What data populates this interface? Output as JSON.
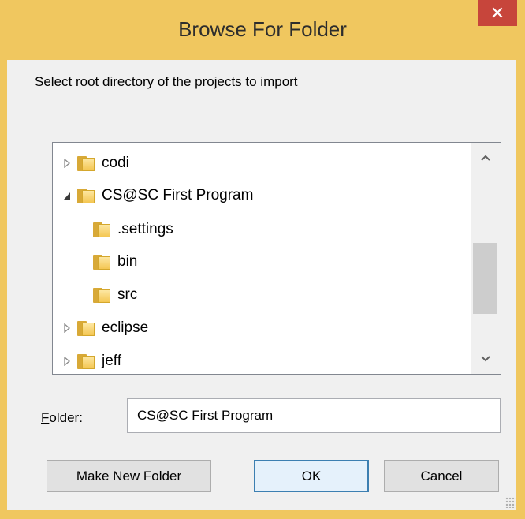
{
  "window": {
    "title": "Browse For Folder",
    "close_symbol": "✕"
  },
  "prompt": "Select root directory of the projects to import",
  "tree": {
    "items": [
      {
        "label": "codi",
        "expander": "collapsed",
        "level": 0
      },
      {
        "label": "CS@SC First Program",
        "expander": "expanded",
        "level": 0,
        "selected": true
      },
      {
        "label": ".settings",
        "expander": "none",
        "level": 1
      },
      {
        "label": "bin",
        "expander": "none",
        "level": 1
      },
      {
        "label": "src",
        "expander": "none",
        "level": 1
      },
      {
        "label": "eclipse",
        "expander": "collapsed",
        "level": 0
      },
      {
        "label": "jeff",
        "expander": "collapsed",
        "level": 0
      }
    ],
    "scroll_up_symbol": "^",
    "scroll_down_symbol": "v"
  },
  "folder_field": {
    "label": "Folder:",
    "accelerator": "F",
    "value": "CS@SC First Program"
  },
  "buttons": {
    "make_new_folder": "Make New Folder",
    "ok": "OK",
    "cancel": "Cancel"
  },
  "colors": {
    "frame": "#f0c75f",
    "close": "#c7453b",
    "selection_fill": "#e6f2fb",
    "selection_border": "#7eb4ea"
  }
}
